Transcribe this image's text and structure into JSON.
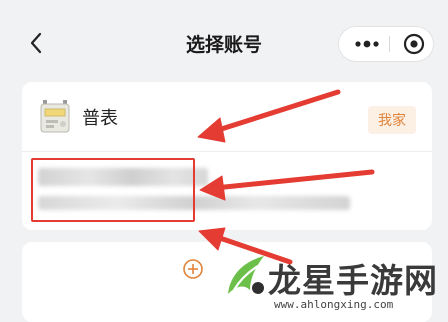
{
  "nav": {
    "title": "选择账号"
  },
  "account": {
    "name": "普表",
    "tag": "我家"
  },
  "watermark": {
    "brand": "龙星手游网",
    "url": "www.ahlongxing.com"
  },
  "colors": {
    "accent_orange": "#e0843b",
    "tag_bg": "#fcefe3",
    "annotation_red": "#e43b33",
    "watermark_green": "#6cc04a"
  }
}
